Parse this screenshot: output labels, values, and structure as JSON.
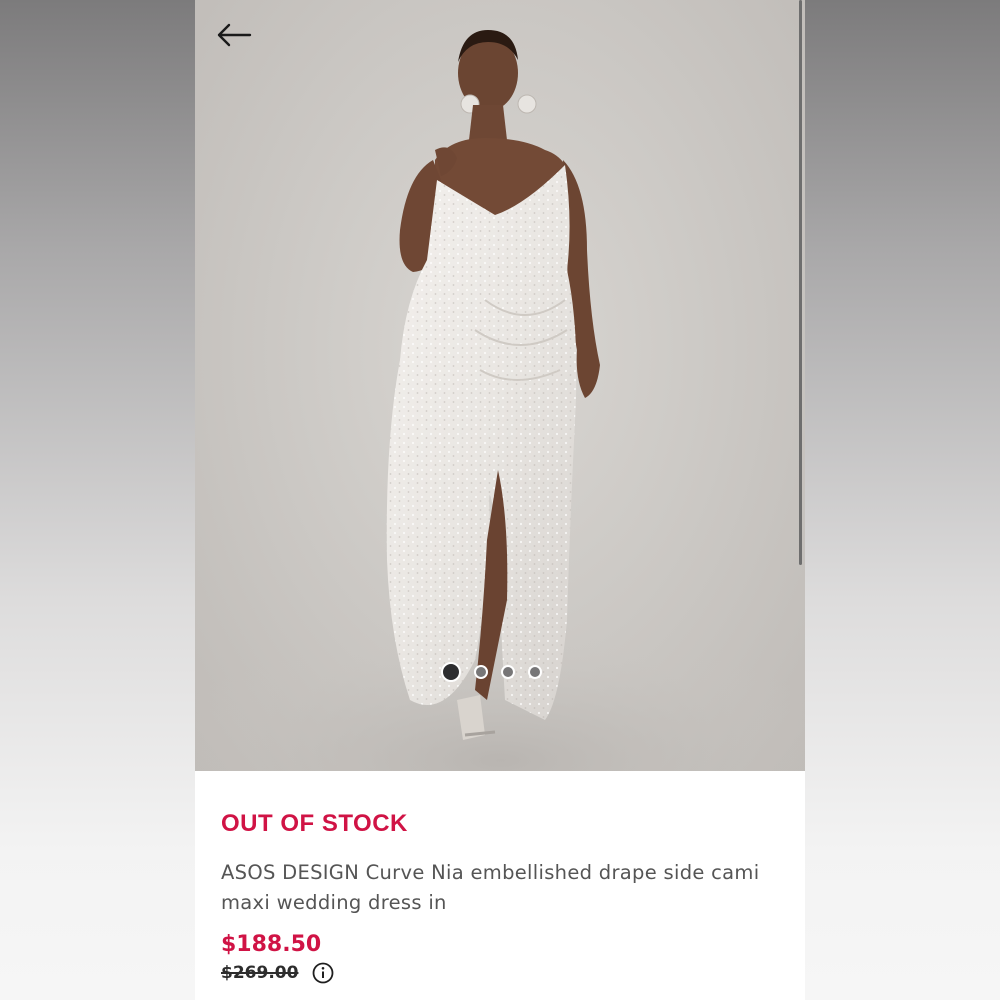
{
  "product": {
    "stock_status": "OUT OF STOCK",
    "title": "ASOS DESIGN Curve Nia embellished drape side cami maxi wedding dress in",
    "price": "$188.50",
    "original_price": "$269.00"
  },
  "gallery": {
    "image_count": 4,
    "active_index": 0,
    "image_subject": "product-photo"
  },
  "icons": {
    "back": "back-arrow-icon",
    "info": "info-icon"
  },
  "colors": {
    "accent": "#d01345",
    "text": "#555555",
    "strikethrough": "#2d2d2d"
  }
}
